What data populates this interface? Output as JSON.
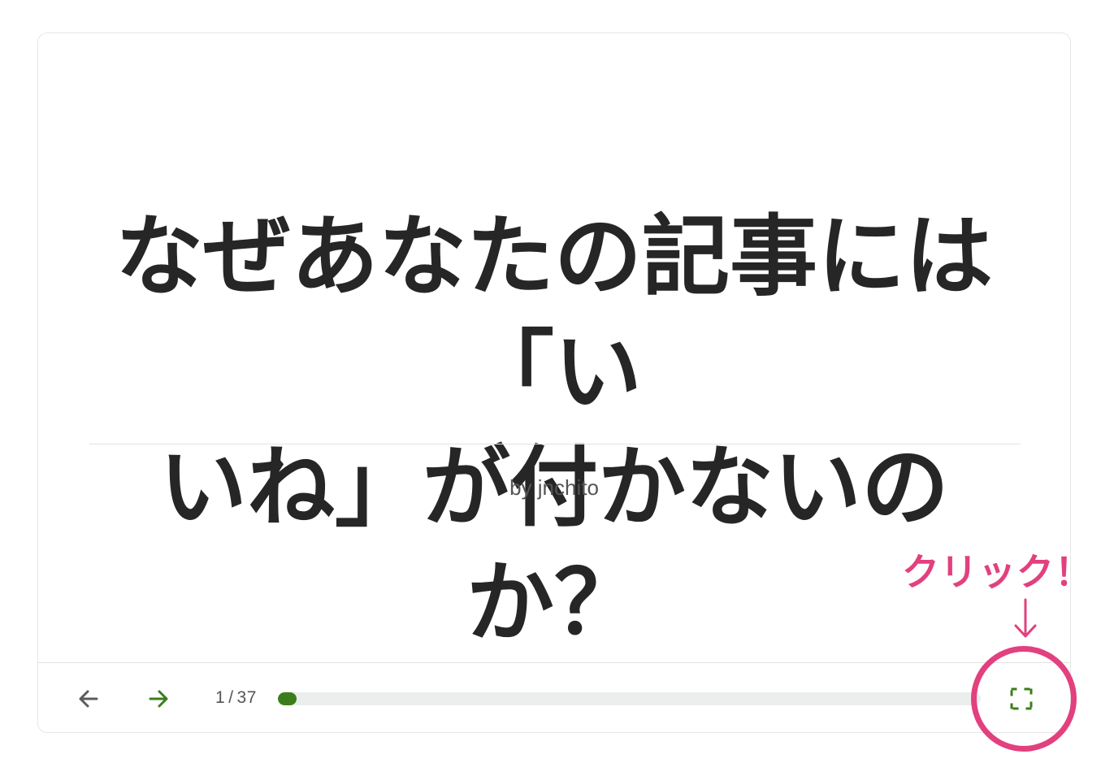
{
  "slide": {
    "title_line1": "なぜあなたの記事には「い",
    "title_line2": "いね」が付かないのか？",
    "author": "by jnchito"
  },
  "controls": {
    "prev_icon": "arrow-left-icon",
    "next_icon": "arrow-right-icon",
    "current_page": "1",
    "separator": "/",
    "total_pages": "37",
    "progress_fraction": 0.027,
    "fullscreen_icon": "fullscreen-icon"
  },
  "annotation": {
    "text": "クリック！",
    "arrow": "↓"
  },
  "colors": {
    "accent_green": "#3b7d1b",
    "annotation_pink": "#e2407e",
    "title_text": "#262626",
    "muted_text": "#555555",
    "track": "#ebeeed"
  }
}
